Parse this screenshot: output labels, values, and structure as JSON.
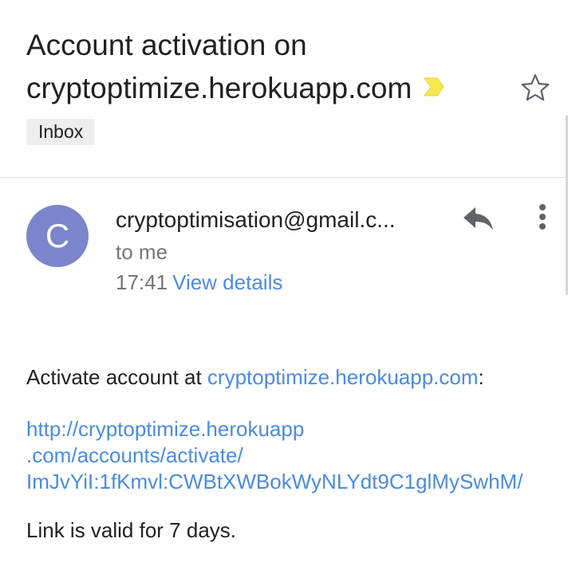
{
  "subject": {
    "line1": "Account activation on",
    "line2": "cryptoptimize.herokuapp.com"
  },
  "label": "Inbox",
  "sender": {
    "avatar_letter": "C",
    "name": "cryptoptimisation@gmail.c...",
    "recipient": "to me",
    "time": "17:41",
    "details_link": "View details"
  },
  "body": {
    "intro_prefix": "Activate account at ",
    "intro_link": "cryptoptimize.herokuapp.com",
    "intro_suffix": ":",
    "url_line1": "http://cryptoptimize.herokuapp",
    "url_line2": ".com/accounts/activate/",
    "url_line3": "ImJvYiI:1fKmvl:CWBtXWBokWyNLYdt9C1glMySwhM/",
    "validity": "Link is valid for 7 days."
  },
  "icons": {
    "importance": "importance-marker-icon",
    "star": "star-outline-icon",
    "reply": "reply-icon",
    "more": "more-vert-icon"
  },
  "colors": {
    "avatar": "#7986cb",
    "link": "#4a8be0",
    "importance": "#f5e94c"
  }
}
